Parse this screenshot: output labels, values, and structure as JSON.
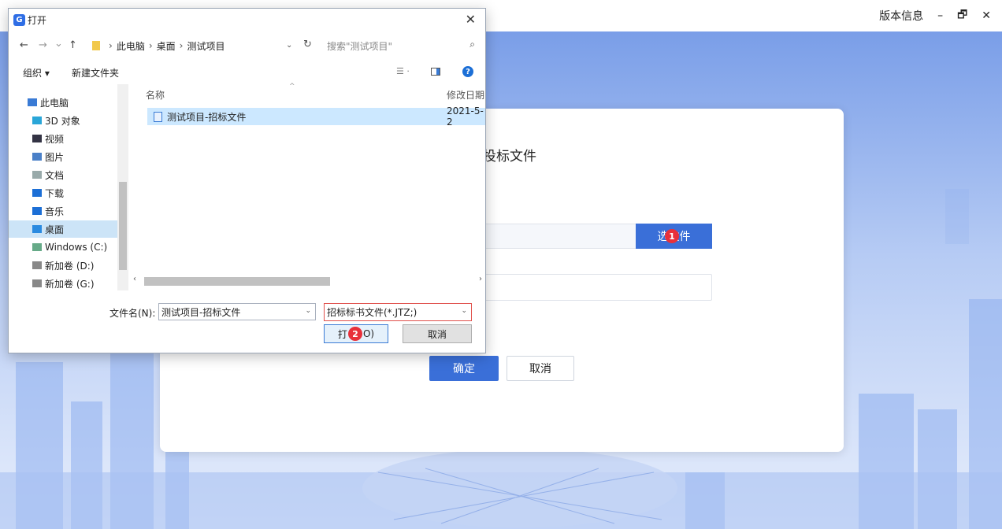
{
  "app": {
    "version_info": "版本信息",
    "minimize_glyph": "–",
    "restore_glyph": "🗗",
    "close_glyph": "✕"
  },
  "main_modal": {
    "title": "投标文件",
    "select_file_label": "选文件",
    "ok_label": "确定",
    "cancel_label": "取消",
    "step1": "1"
  },
  "dialog": {
    "title": "打开",
    "close_glyph": "✕",
    "nav": {
      "back": "←",
      "forward": "→",
      "recent": "⌄",
      "up": "↑"
    },
    "breadcrumb": [
      "此电脑",
      "桌面",
      "测试项目"
    ],
    "search_placeholder": "搜索\"测试项目\"",
    "toolbar": {
      "organize": "组织 ▾",
      "new_folder": "新建文件夹",
      "help": "?"
    },
    "nav_items": [
      {
        "label": "此电脑",
        "icon": "computer-icon",
        "color": "#3a7bd5"
      },
      {
        "label": "3D 对象",
        "icon": "cube-icon",
        "color": "#2aa6d8"
      },
      {
        "label": "视频",
        "icon": "video-icon",
        "color": "#334"
      },
      {
        "label": "图片",
        "icon": "picture-icon",
        "color": "#4a80c8"
      },
      {
        "label": "文档",
        "icon": "document-icon",
        "color": "#9aa"
      },
      {
        "label": "下载",
        "icon": "download-icon",
        "color": "#1c6fd6"
      },
      {
        "label": "音乐",
        "icon": "music-icon",
        "color": "#1c6fd6"
      },
      {
        "label": "桌面",
        "icon": "desktop-icon",
        "color": "#2a8ae0"
      },
      {
        "label": "Windows (C:)",
        "icon": "drive-icon",
        "color": "#6a8"
      },
      {
        "label": "新加卷 (D:)",
        "icon": "drive-icon",
        "color": "#888"
      },
      {
        "label": "新加卷 (G:)",
        "icon": "drive-icon",
        "color": "#888"
      }
    ],
    "columns": {
      "name": "名称",
      "date": "修改日期"
    },
    "files": [
      {
        "name": "测试项目-招标文件",
        "date": "2021-5-2"
      }
    ],
    "filename_label": "文件名(N):",
    "filename_value": "测试项目-招标文件",
    "filetype_value": "招标标书文件(*.JTZ;)",
    "open_label_a": "打",
    "open_label_b": "O)",
    "cancel_label": "取消",
    "step2": "2"
  }
}
